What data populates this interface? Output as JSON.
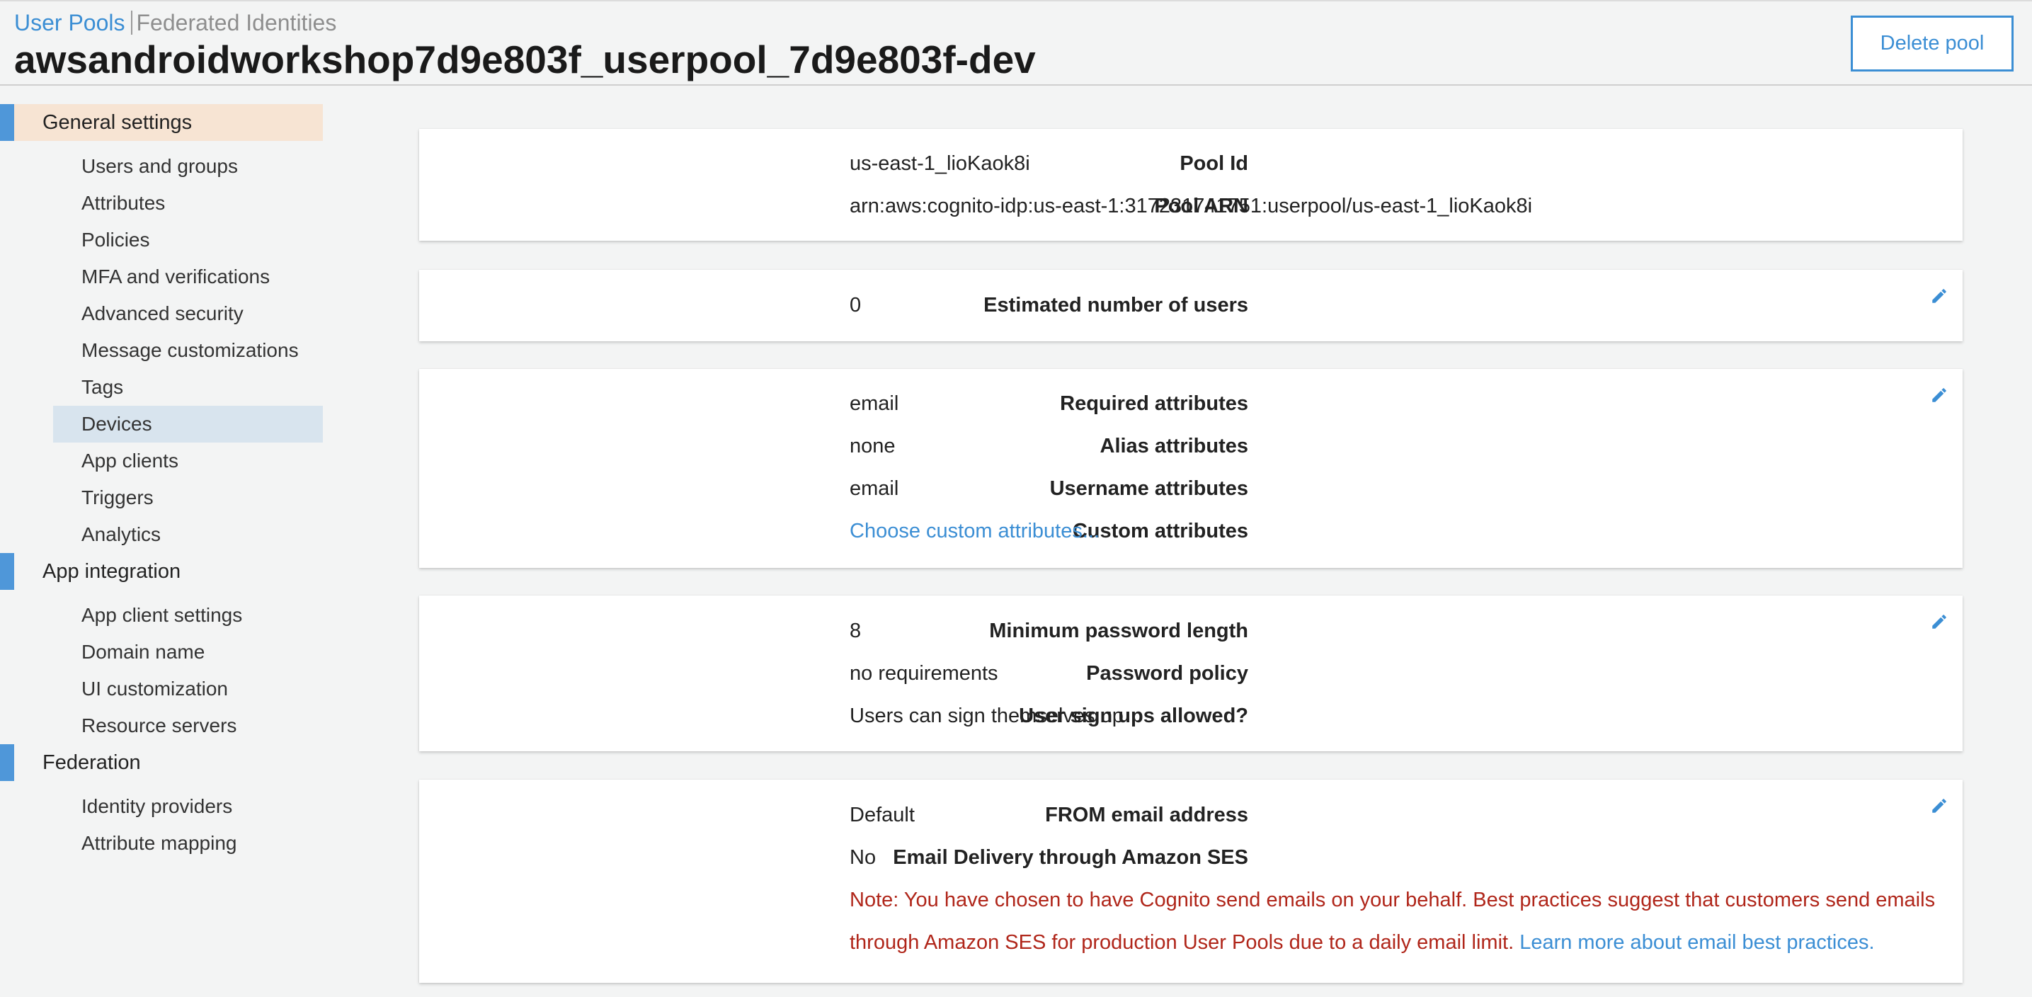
{
  "breadcrumb": {
    "user_pools": "User Pools",
    "federated_identities": "Federated Identities"
  },
  "page_title": "awsandroidworkshop7d9e803f_userpool_7d9e803f-dev",
  "delete_button": "Delete pool",
  "sidebar": {
    "sections": [
      {
        "label": "General settings",
        "active": true,
        "items": [
          "Users and groups",
          "Attributes",
          "Policies",
          "MFA and verifications",
          "Advanced security",
          "Message customizations",
          "Tags",
          "Devices",
          "App clients",
          "Triggers",
          "Analytics"
        ]
      },
      {
        "label": "App integration",
        "items": [
          "App client settings",
          "Domain name",
          "UI customization",
          "Resource servers"
        ]
      },
      {
        "label": "Federation",
        "items": [
          "Identity providers",
          "Attribute mapping"
        ]
      }
    ],
    "selected_item": "Devices"
  },
  "pool": {
    "id_label": "Pool Id",
    "id_value": "us-east-1_lioKaok8i",
    "arn_label": "Pool ARN",
    "arn_value": "arn:aws:cognito-idp:us-east-1:317231741751:userpool/us-east-1_lioKaok8i"
  },
  "users": {
    "estimated_label": "Estimated number of users",
    "estimated_value": "0"
  },
  "attributes": {
    "required_label": "Required attributes",
    "required_value": "email",
    "alias_label": "Alias attributes",
    "alias_value": "none",
    "username_label": "Username attributes",
    "username_value": "email",
    "custom_label": "Custom attributes",
    "custom_link": "Choose custom attributes..."
  },
  "policies": {
    "min_length_label": "Minimum password length",
    "min_length_value": "8",
    "policy_label": "Password policy",
    "policy_value": "no requirements",
    "signup_label": "User sign ups allowed?",
    "signup_value": "Users can sign themselves up"
  },
  "email": {
    "from_label": "FROM email address",
    "from_value": "Default",
    "ses_label": "Email Delivery through Amazon SES",
    "ses_value": "No",
    "note": "Note: You have chosen to have Cognito send emails on your behalf. Best practices suggest that customers send emails through Amazon SES for production User Pools due to a daily email limit.",
    "note_link": "Learn more about email best practices."
  },
  "colors": {
    "link": "#3b8ed4",
    "accent_bar": "#4f97d9",
    "active_bg": "#f7e4d3",
    "selected_bg": "#d8e4ee",
    "warning": "#b0261a"
  },
  "icons": {
    "edit": "pencil-icon"
  }
}
